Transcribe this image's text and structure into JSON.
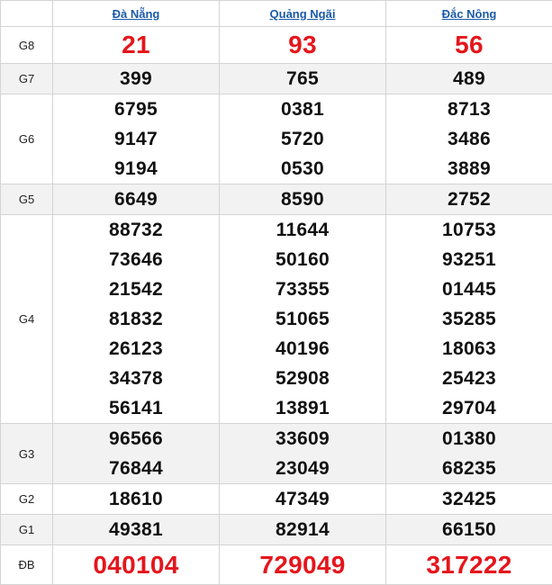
{
  "table": {
    "provinces": [
      "Đà Nẵng",
      "Quảng Ngãi",
      "Đắc Nông"
    ],
    "rows": [
      {
        "label": "G8",
        "big": true,
        "values": [
          [
            "21"
          ],
          [
            "93"
          ],
          [
            "56"
          ]
        ]
      },
      {
        "label": "G7",
        "big": false,
        "values": [
          [
            "399"
          ],
          [
            "765"
          ],
          [
            "489"
          ]
        ]
      },
      {
        "label": "G6",
        "big": false,
        "values": [
          [
            "6795",
            "9147",
            "9194"
          ],
          [
            "0381",
            "5720",
            "0530"
          ],
          [
            "8713",
            "3486",
            "3889"
          ]
        ]
      },
      {
        "label": "G5",
        "big": false,
        "values": [
          [
            "6649"
          ],
          [
            "8590"
          ],
          [
            "2752"
          ]
        ]
      },
      {
        "label": "G4",
        "big": false,
        "values": [
          [
            "88732",
            "73646",
            "21542",
            "81832",
            "26123",
            "34378",
            "56141"
          ],
          [
            "11644",
            "50160",
            "73355",
            "51065",
            "40196",
            "52908",
            "13891"
          ],
          [
            "10753",
            "93251",
            "01445",
            "35285",
            "18063",
            "25423",
            "29704"
          ]
        ]
      },
      {
        "label": "G3",
        "big": false,
        "values": [
          [
            "96566",
            "76844"
          ],
          [
            "33609",
            "23049"
          ],
          [
            "01380",
            "68235"
          ]
        ]
      },
      {
        "label": "G2",
        "big": false,
        "values": [
          [
            "18610"
          ],
          [
            "47349"
          ],
          [
            "32425"
          ]
        ]
      },
      {
        "label": "G1",
        "big": false,
        "values": [
          [
            "49381"
          ],
          [
            "82914"
          ],
          [
            "66150"
          ]
        ]
      },
      {
        "label": "ĐB",
        "big": true,
        "values": [
          [
            "040104"
          ],
          [
            "729049"
          ],
          [
            "317222"
          ]
        ]
      }
    ]
  },
  "colors": {
    "highlight_red": "#e4161c",
    "link_blue": "#1a5aa8",
    "alt_row": "#f2f2f2",
    "border": "#d4d4d4"
  }
}
